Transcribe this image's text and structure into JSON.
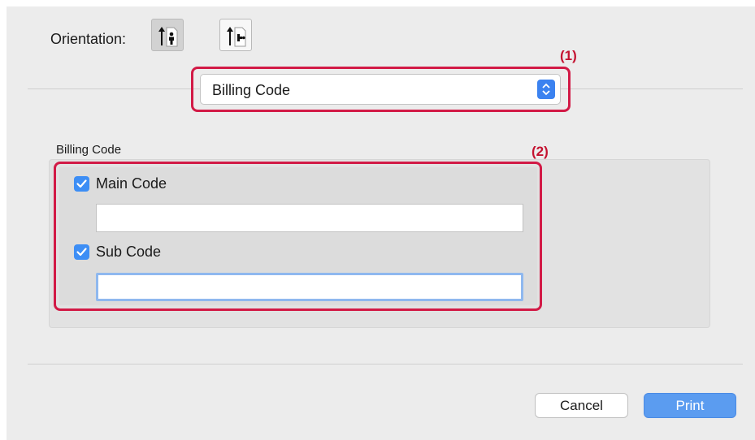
{
  "orientation": {
    "label": "Orientation:",
    "options": [
      {
        "name": "portrait",
        "icon": "portrait-orientation-icon",
        "selected": true
      },
      {
        "name": "landscape",
        "icon": "landscape-orientation-icon",
        "selected": false
      }
    ]
  },
  "panel_select": {
    "value": "Billing Code",
    "icon": "up-down-arrows-icon"
  },
  "callouts": {
    "one": "(1)",
    "two": "(2)"
  },
  "billing_group": {
    "title": "Billing Code",
    "main_code": {
      "label": "Main Code",
      "checked": true,
      "value": ""
    },
    "sub_code": {
      "label": "Sub Code",
      "checked": true,
      "value": ""
    }
  },
  "buttons": {
    "cancel": "Cancel",
    "print": "Print"
  },
  "colors": {
    "accent": "#3d8ef5",
    "callout": "#d21a46",
    "primary_button": "#5b9cf0"
  }
}
